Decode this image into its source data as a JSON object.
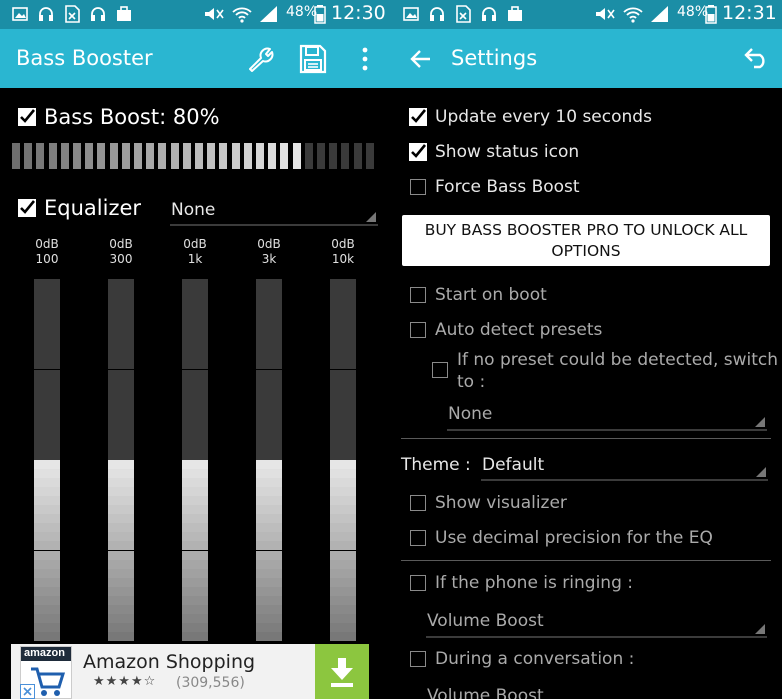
{
  "left": {
    "status": {
      "battery": "48%",
      "time": "12:30"
    },
    "app_title": "Bass Booster",
    "toolbar_icons": [
      "wrench-icon",
      "save-icon",
      "overflow-menu-icon"
    ],
    "bass_boost": {
      "label": "Bass Boost: 80%",
      "checked": true,
      "level": 0.8
    },
    "equalizer": {
      "label": "Equalizer",
      "checked": true,
      "preset": "None"
    },
    "eq_bands": [
      {
        "gain": "0dB",
        "freq": "100"
      },
      {
        "gain": "0dB",
        "freq": "300"
      },
      {
        "gain": "0dB",
        "freq": "1k"
      },
      {
        "gain": "0dB",
        "freq": "3k"
      },
      {
        "gain": "0dB",
        "freq": "10k"
      }
    ],
    "ad": {
      "logo_text": "amazon",
      "title": "Amazon Shopping",
      "stars": "★★★★☆",
      "reviews": "(309,556)"
    }
  },
  "right": {
    "status": {
      "battery": "48%",
      "time": "12:31"
    },
    "app_title": "Settings",
    "options": {
      "update": {
        "label": "Update every 10 seconds",
        "checked": true
      },
      "status_icon": {
        "label": "Show status icon",
        "checked": true
      },
      "force": {
        "label": "Force Bass Boost",
        "checked": false
      },
      "buy_button": "BUY BASS BOOSTER PRO TO UNLOCK ALL OPTIONS",
      "start_boot": {
        "label": "Start on boot",
        "checked": false
      },
      "auto_detect": {
        "label": "Auto detect presets",
        "checked": false
      },
      "no_preset": {
        "label_line1": "If no preset could be detected, switch",
        "label_line2": "to :",
        "checked": false
      },
      "no_preset_value": "None",
      "theme_label": "Theme :",
      "theme_value": "Default",
      "visualizer": {
        "label": "Show visualizer",
        "checked": false
      },
      "decimal": {
        "label": "Use decimal precision for the EQ",
        "checked": false
      },
      "ringing": {
        "label": "If the phone is ringing :",
        "checked": false
      },
      "ringing_value": "Volume Boost",
      "conversation": {
        "label": "During a conversation :",
        "checked": false
      },
      "conversation_value": "Volume Boost"
    }
  },
  "colors": {
    "status_bar": "#1b8ea6",
    "app_bar": "#2ab6d1",
    "ad_download": "#8cc63f"
  }
}
